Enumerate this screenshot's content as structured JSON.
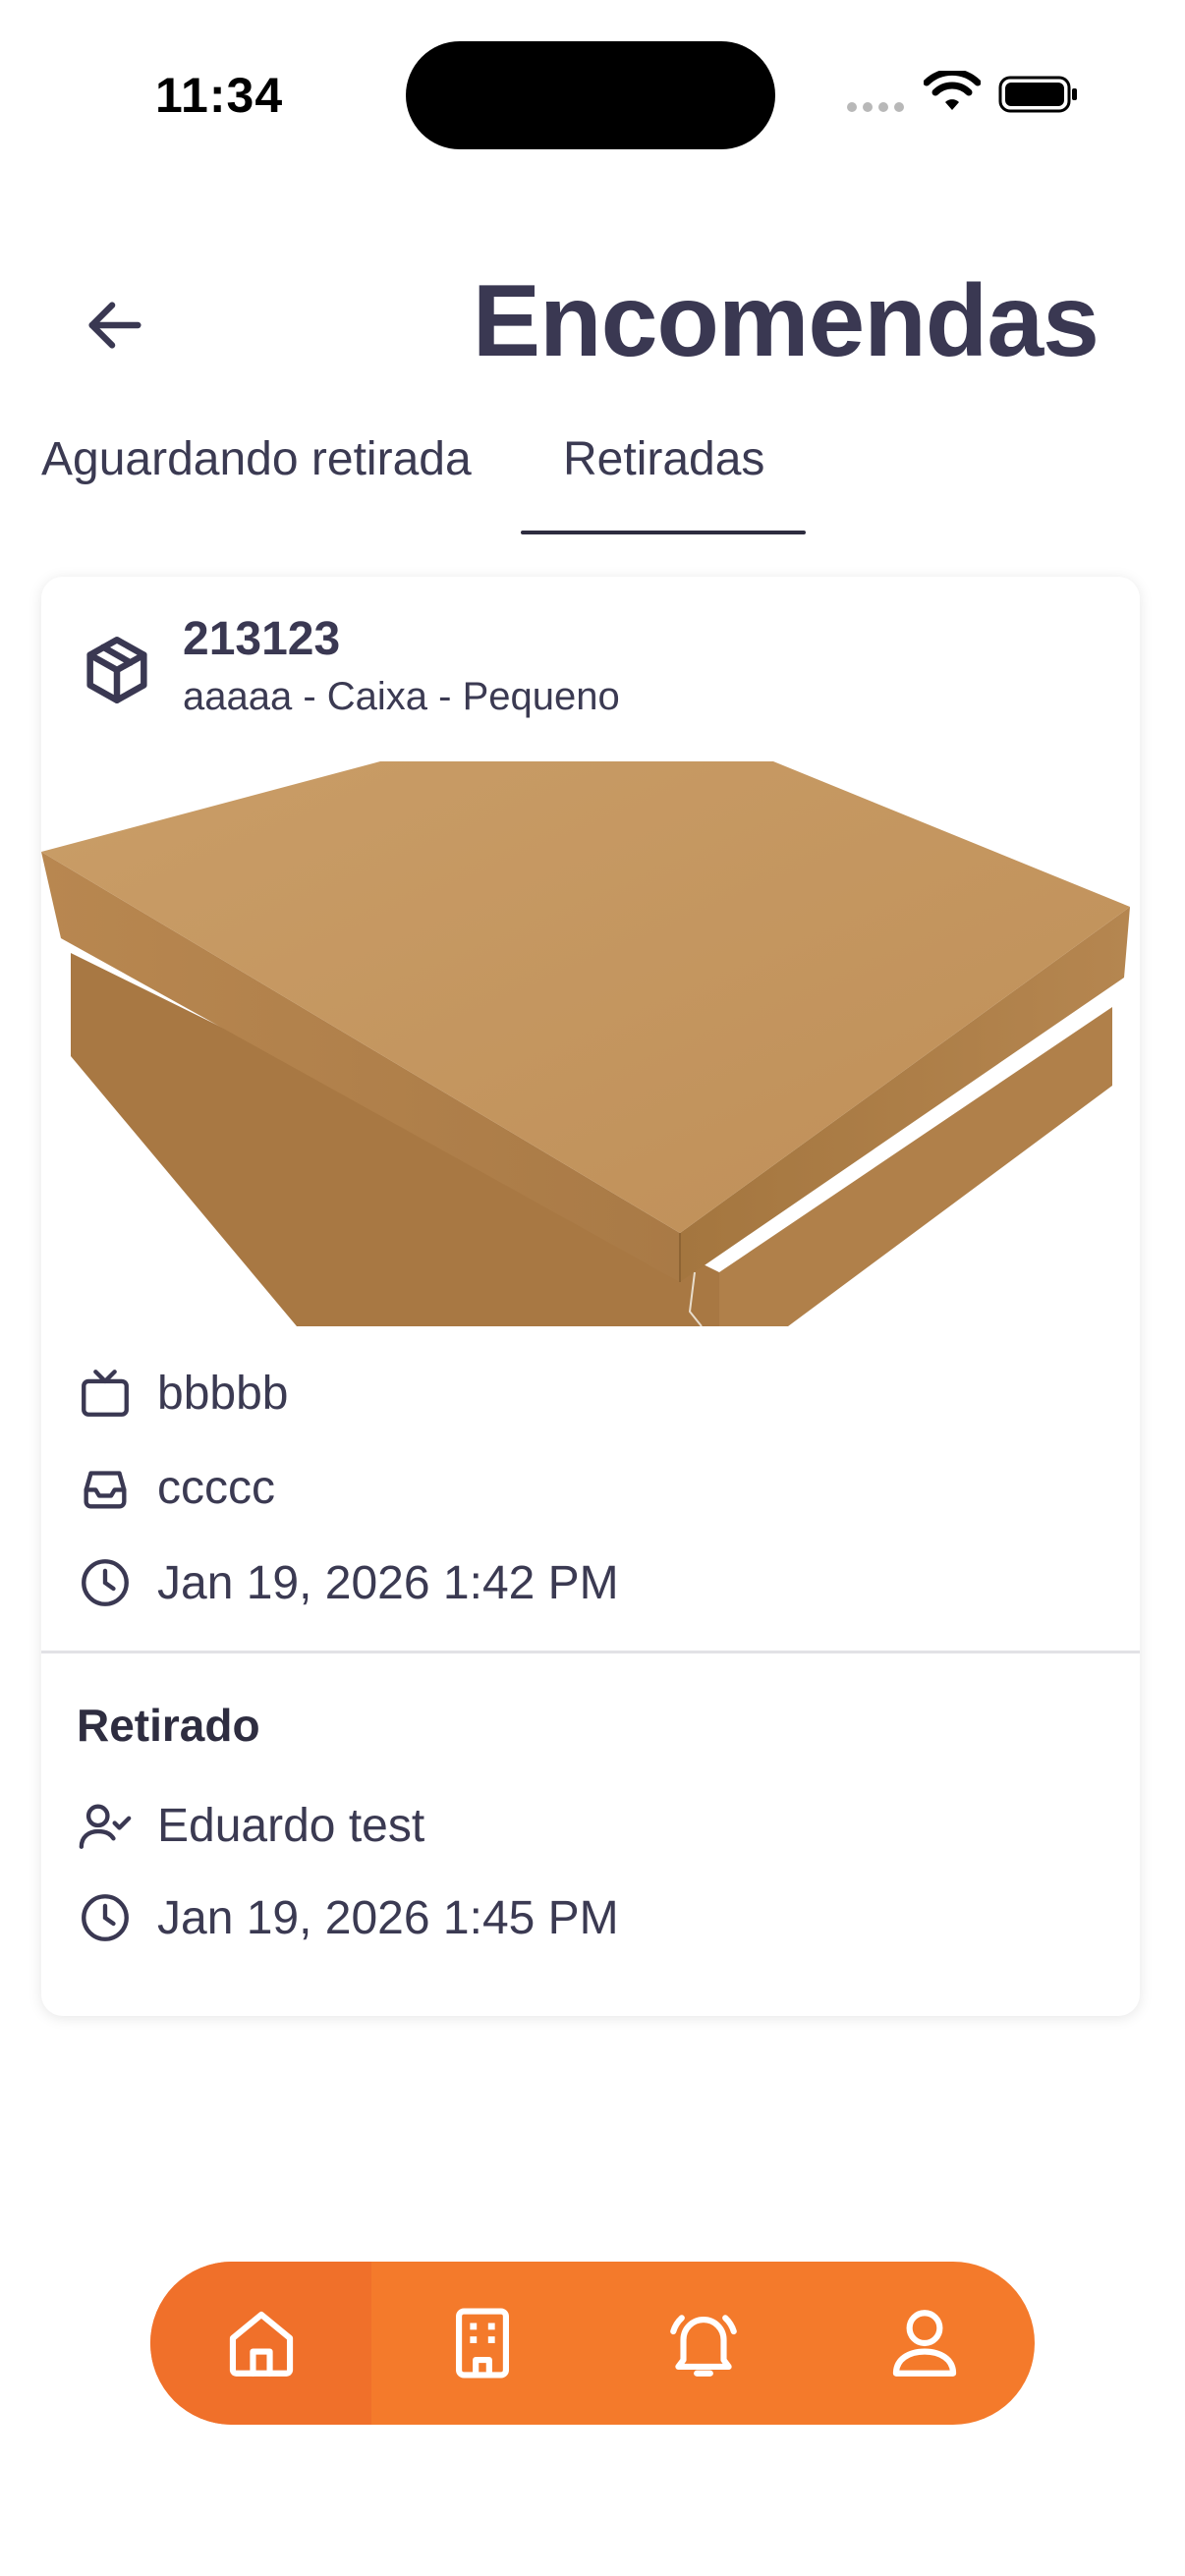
{
  "status_bar": {
    "time": "11:34"
  },
  "header": {
    "title": "Encomendas",
    "back_icon": "arrow-left-icon"
  },
  "tabs": [
    {
      "label": "Aguardando retirada",
      "active": false
    },
    {
      "label": "Retiradas",
      "active": true
    }
  ],
  "card": {
    "code": "213123",
    "subtitle": "aaaaa - Caixa - Pequeno",
    "icon": "package-icon",
    "photo_icon": "cardboard-box-photo",
    "unit": "bbbbb",
    "unit_icon": "tv-icon",
    "box": "ccccc",
    "box_icon": "inbox-icon",
    "received_at": "Jan 19, 2026 1:42 PM",
    "received_icon": "clock-icon",
    "retrieved": {
      "title": "Retirado",
      "person": "Eduardo test",
      "person_icon": "user-check-icon",
      "time": "Jan 19, 2026 1:45 PM",
      "time_icon": "clock-icon"
    }
  },
  "bottom_nav": {
    "items": [
      {
        "name": "home",
        "icon": "home-icon",
        "active": true
      },
      {
        "name": "building",
        "icon": "building-icon",
        "active": false
      },
      {
        "name": "notifications",
        "icon": "bell-ringing-icon",
        "active": false
      },
      {
        "name": "profile",
        "icon": "user-icon",
        "active": false
      }
    ]
  },
  "colors": {
    "accent": "#f47a2b",
    "text": "#3b3a52"
  }
}
